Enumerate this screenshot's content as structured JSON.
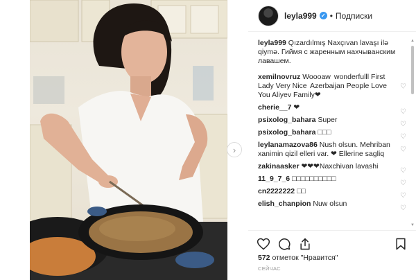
{
  "post": {
    "username": "leyla999",
    "verified_mark": "✓",
    "separator": "•",
    "follow_label": "Подписки",
    "caption_user": "leyla999",
    "caption_text": " Qızardılmış Naxçıvan lavaşı ilə qiymə. Гиймя с жаренным нахчыванским лавашем."
  },
  "comments": [
    {
      "user": "xemilnovruz",
      "text": " Woooaw  wonderfulll First Lady Very Nice  Azerbaijan People Love You Aliyev Family❤"
    },
    {
      "user": "cherie__7",
      "text": " ❤"
    },
    {
      "user": "psixolog_bahara",
      "text": " Super "
    },
    {
      "user": "psixolog_bahara",
      "text": " □□□"
    },
    {
      "user": "leylanamazova86",
      "text": " Nush olsun. Mehriban xanimin qizil elleri var. ❤ Ellerine sagliq"
    },
    {
      "user": "zakinaasker",
      "text": " ❤❤❤Naxchivan lavashi"
    },
    {
      "user": "11_9_7_6",
      "text": " □□□□□□□□□□"
    },
    {
      "user": "cn2222222",
      "text": " □□"
    },
    {
      "user": "elish_chanpion",
      "text": " Nuw olsun "
    }
  ],
  "icons": {
    "heart": "heart-icon",
    "comment": "comment-icon",
    "share": "share-icon",
    "save": "bookmark-icon",
    "next": "chevron-right-icon"
  },
  "footer": {
    "likes_count": "572",
    "likes_text": " отметок \"Нравится\"",
    "time_label": "СЕЙЧАС"
  },
  "colors": {
    "link_blue": "#3897f0",
    "text": "#262626",
    "muted": "#999999"
  }
}
